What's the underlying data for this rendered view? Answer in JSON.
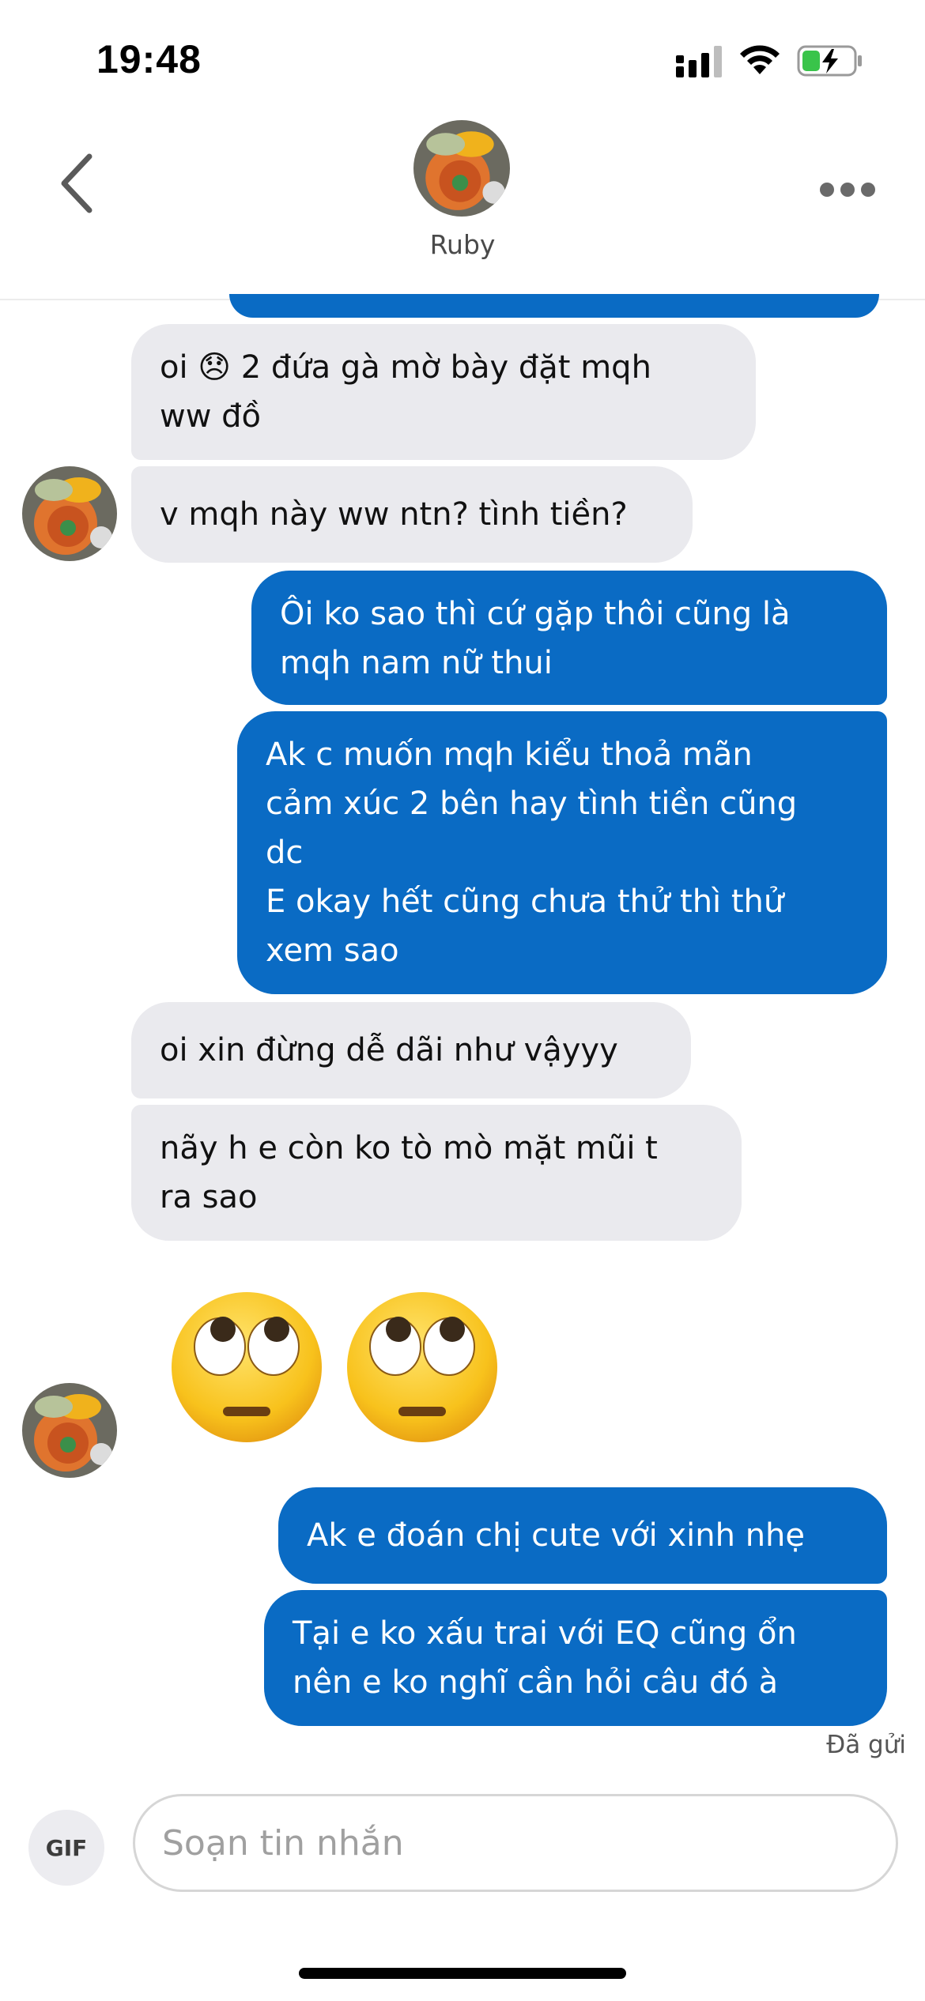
{
  "status_bar": {
    "time": "19:48",
    "battery_charging": true
  },
  "header": {
    "contact_name": "Ruby"
  },
  "messages": [
    {
      "side": "received",
      "text": "oi 😞 2 đứa gà mờ bày đặt mqh\nww đồ"
    },
    {
      "side": "received",
      "text": "v mqh này ww ntn? tình tiền?"
    },
    {
      "side": "sent",
      "text": "Ôi ko sao thì cứ gặp thôi cũng là\nmqh nam nữ thui"
    },
    {
      "side": "sent",
      "text": "Ak c muốn mqh kiểu thoả mãn\ncảm xúc 2 bên hay tình tiền cũng\ndc\nE okay hết cũng chưa thử thì thử\nxem sao"
    },
    {
      "side": "received",
      "text": "oi xin đừng dễ dãi như vậyyy"
    },
    {
      "side": "received",
      "text": "nãy h e còn ko tò mò mặt mũi t\nra sao"
    },
    {
      "side": "received",
      "emoji": "face-with-rolling-eyes x2"
    },
    {
      "side": "sent",
      "text": "Ak e đoán chị cute với xinh nhẹ"
    },
    {
      "side": "sent",
      "text": "Tại e ko xấu trai với EQ cũng ổn\nnên e ko nghĩ cần hỏi câu đó à"
    }
  ],
  "delivery_status": "Đã gửi",
  "composer": {
    "gif_label": "GIF",
    "placeholder": "Soạn tin nhắn"
  },
  "colors": {
    "sent_bubble": "#0a6bc4",
    "received_bubble": "#eaeaee"
  },
  "icons": [
    "back-chevron-icon",
    "more-dots-icon",
    "signal-icon",
    "wifi-icon",
    "battery-icon"
  ]
}
